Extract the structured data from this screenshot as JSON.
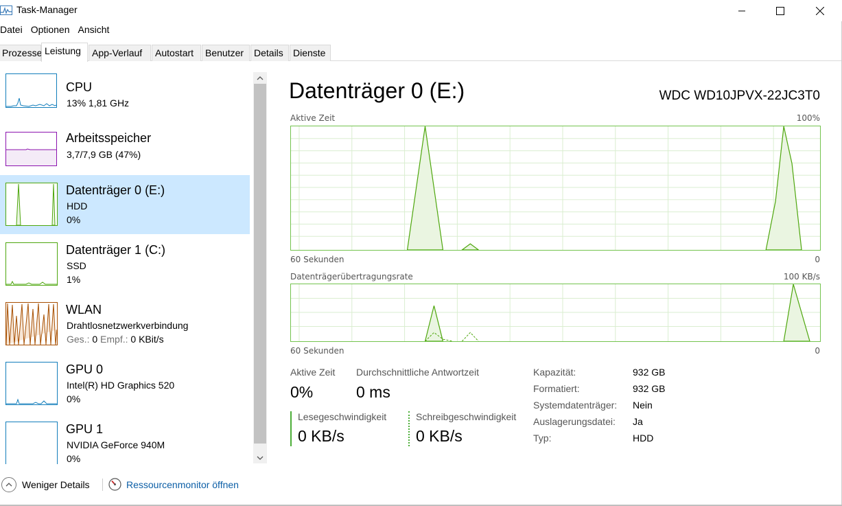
{
  "window": {
    "title": "Task-Manager"
  },
  "menu": [
    "Datei",
    "Optionen",
    "Ansicht"
  ],
  "tabs": [
    "Prozesse",
    "Leistung",
    "App-Verlauf",
    "Autostart",
    "Benutzer",
    "Details",
    "Dienste"
  ],
  "active_tab": "Leistung",
  "sidebar": {
    "items": [
      {
        "title": "CPU",
        "line1": "13%  1,81 GHz",
        "line2": "",
        "color": "#117dbb"
      },
      {
        "title": "Arbeitsspeicher",
        "line1": "3,7/7,9 GB (47%)",
        "line2": "",
        "color": "#8b12ae"
      },
      {
        "title": "Datenträger 0 (E:)",
        "line1": "HDD",
        "line2": "0%",
        "color": "#4da60c"
      },
      {
        "title": "Datenträger 1 (C:)",
        "line1": "SSD",
        "line2": "1%",
        "color": "#4da60c"
      },
      {
        "title": "WLAN",
        "line1": "Drahtlosnetzwerkverbindung",
        "line2_a": "Ges.:",
        "line2_b": "0",
        "line2_c": "Empf.:",
        "line2_d": "0 KBit/s",
        "color": "#a74f01"
      },
      {
        "title": "GPU 0",
        "line1": "Intel(R) HD Graphics 520",
        "line2": "0%",
        "color": "#117dbb"
      },
      {
        "title": "GPU 1",
        "line1": "NVIDIA GeForce 940M",
        "line2": "0%",
        "color": "#117dbb"
      }
    ]
  },
  "detail": {
    "title": "Datenträger 0 (E:)",
    "model": "WDC WD10JPVX-22JC3T0",
    "graph1": {
      "label": "Aktive Zeit",
      "max": "100%",
      "x_left": "60 Sekunden",
      "x_right": "0"
    },
    "graph2": {
      "label": "Datenträgerübertragungsrate",
      "max": "100 KB/s",
      "x_left": "60 Sekunden",
      "x_right": "0"
    },
    "stats": {
      "active_label": "Aktive Zeit",
      "active_value": "0%",
      "resp_label": "Durchschnittliche Antwortzeit",
      "resp_value": "0 ms",
      "read_label": "Lesegeschwindigkeit",
      "read_value": "0 KB/s",
      "write_label": "Schreibgeschwindigkeit",
      "write_value": "0 KB/s"
    },
    "properties": [
      {
        "label": "Kapazität:",
        "value": "932 GB"
      },
      {
        "label": "Formatiert:",
        "value": "932 GB"
      },
      {
        "label": "Systemdatenträger:",
        "value": "Nein"
      },
      {
        "label": "Auslagerungsdatei:",
        "value": "Ja"
      },
      {
        "label": "Typ:",
        "value": "HDD"
      }
    ]
  },
  "footer": {
    "less_details": "Weniger Details",
    "resource_monitor": "Ressourcenmonitor öffnen"
  },
  "colors": {
    "disk": "#4da60c",
    "selected_bg": "#cce8ff",
    "link": "#0b5ea6"
  }
}
